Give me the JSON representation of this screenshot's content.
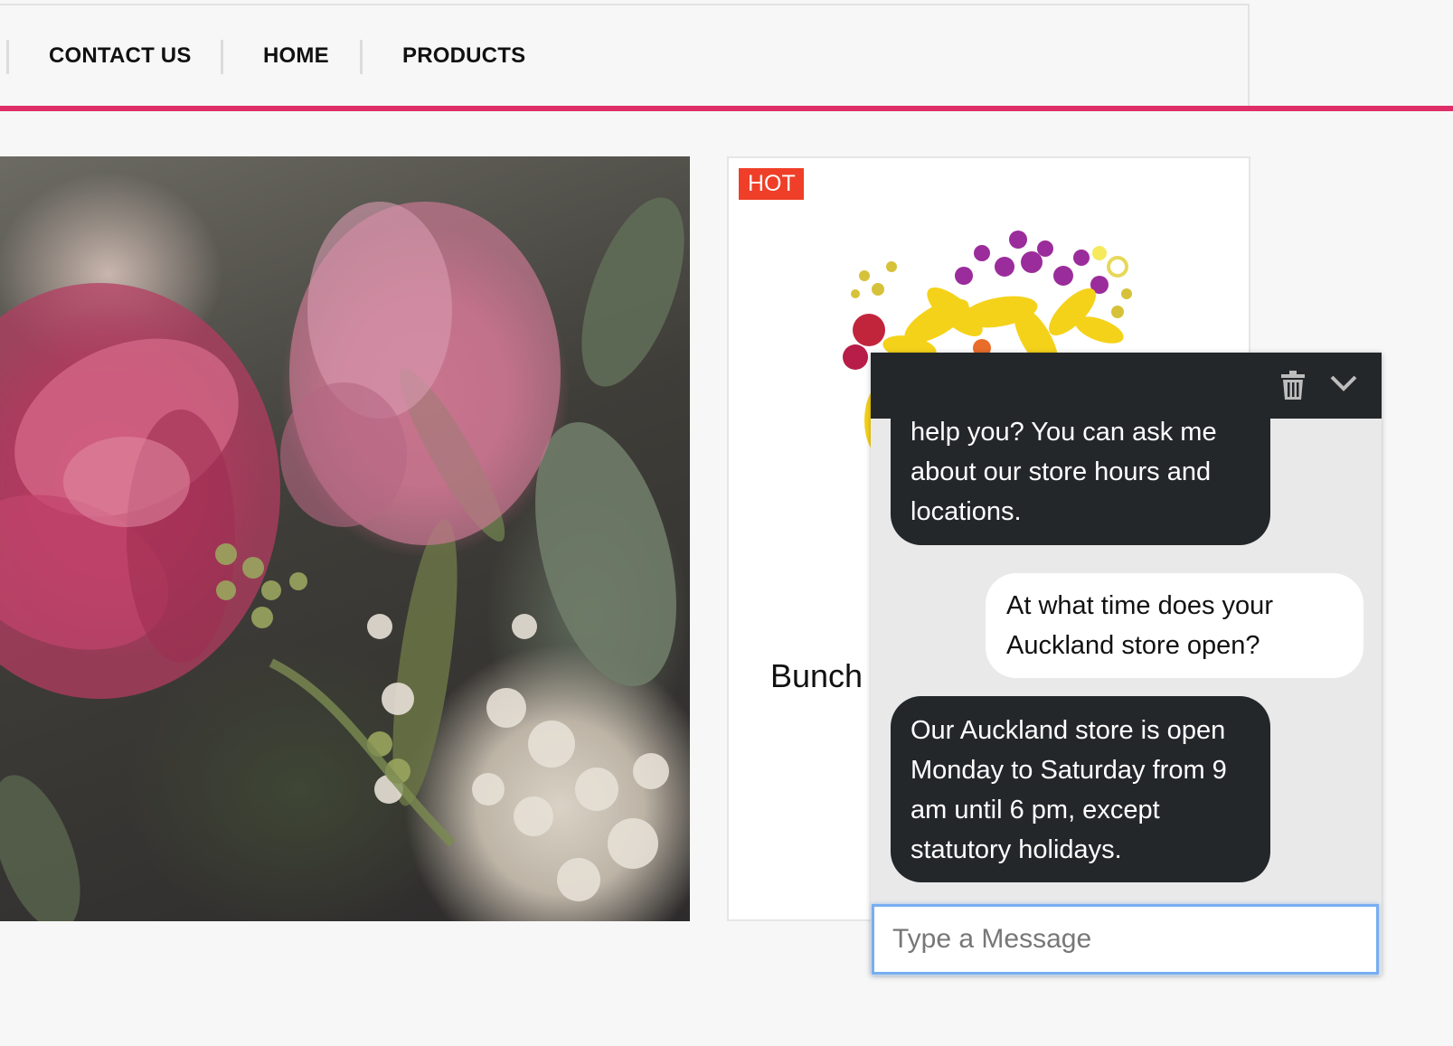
{
  "nav": {
    "items": [
      {
        "label": "CONTACT US"
      },
      {
        "label": "HOME"
      },
      {
        "label": "PRODUCTS"
      }
    ],
    "accent_color": "#df2d67"
  },
  "product": {
    "badge": "HOT",
    "badge_color": "#ef3f28",
    "name_partial": "Bunch"
  },
  "chat": {
    "header_icons": [
      "trash-icon",
      "chevron-down-icon"
    ],
    "messages": [
      {
        "from": "bot",
        "text": "help you? You can ask me about our store hours and locations."
      },
      {
        "from": "user",
        "text": "At what time does your Auckland store open?"
      },
      {
        "from": "bot",
        "text": "Our Auckland store is open Monday to Saturday from 9 am until 6 pm, except statutory holidays."
      }
    ],
    "input_placeholder": "Type a Message"
  }
}
